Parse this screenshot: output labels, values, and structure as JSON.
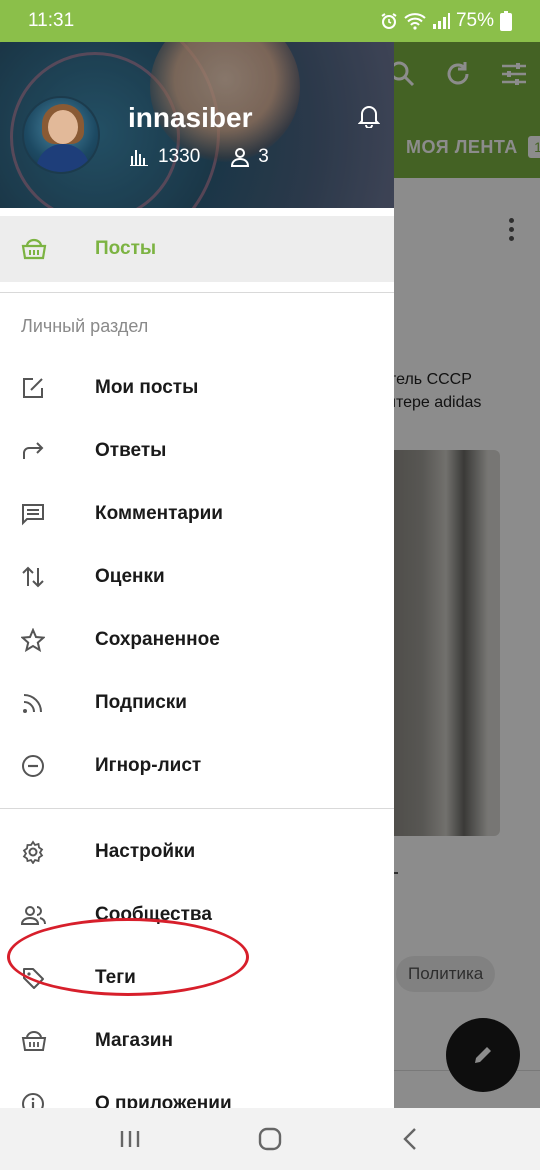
{
  "status_bar": {
    "time": "11:31",
    "battery": "75%"
  },
  "background": {
    "tab_label": "МОЯ ЛЕНТА",
    "tab_count": "1",
    "post_text_lines": [
      "итель СССР",
      "китере adidas"
    ],
    "tag_chip": "Политика",
    "accent_color": "#7cb342"
  },
  "drawer": {
    "profile": {
      "username": "innasiber",
      "rating": "1330",
      "subscribers": "3"
    },
    "active_item": {
      "label": "Посты",
      "icon": "shop-basket-icon"
    },
    "section_title": "Личный раздел",
    "personal_items": [
      {
        "label": "Мои посты",
        "icon": "edit-square-icon"
      },
      {
        "label": "Ответы",
        "icon": "reply-arrow-icon"
      },
      {
        "label": "Комментарии",
        "icon": "comment-icon"
      },
      {
        "label": "Оценки",
        "icon": "sort-arrows-icon"
      },
      {
        "label": "Сохраненное",
        "icon": "star-icon"
      },
      {
        "label": "Подписки",
        "icon": "rss-icon"
      },
      {
        "label": "Игнор-лист",
        "icon": "block-icon"
      }
    ],
    "other_items": [
      {
        "label": "Настройки",
        "icon": "gear-icon"
      },
      {
        "label": "Сообщества",
        "icon": "people-icon"
      },
      {
        "label": "Теги",
        "icon": "tag-icon"
      },
      {
        "label": "Магазин",
        "icon": "shop-basket-icon"
      },
      {
        "label": "О приложении",
        "icon": "info-icon"
      }
    ],
    "highlight_color": "#d71f2b"
  }
}
